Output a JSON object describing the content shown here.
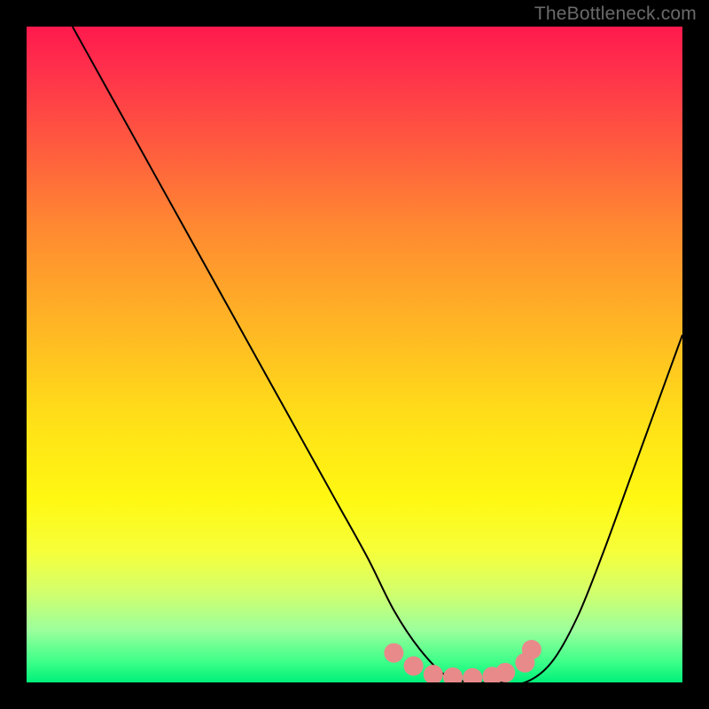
{
  "attribution": "TheBottleneck.com",
  "chart_data": {
    "type": "line",
    "title": "",
    "xlabel": "",
    "ylabel": "",
    "xlim": [
      0,
      100
    ],
    "ylim": [
      0,
      100
    ],
    "series": [
      {
        "name": "bottleneck-curve",
        "x": [
          7,
          12,
          17,
          22,
          27,
          32,
          37,
          42,
          47,
          52,
          56,
          60,
          64,
          68,
          72,
          76,
          80,
          84,
          88,
          92,
          96,
          100
        ],
        "values": [
          100,
          91,
          82,
          73,
          64,
          55,
          46,
          37,
          28,
          19,
          11,
          5,
          1,
          0,
          0,
          0,
          3,
          10,
          20,
          31,
          42,
          53
        ]
      },
      {
        "name": "highlight-dots",
        "x": [
          56,
          59,
          62,
          65,
          68,
          71,
          73,
          76,
          77
        ],
        "values": [
          4.5,
          2.5,
          1.2,
          0.8,
          0.7,
          0.9,
          1.5,
          3,
          5
        ]
      }
    ],
    "colors": {
      "curve": "#000000",
      "highlight": "#e88a8a",
      "gradient_top": "#ff1a4d",
      "gradient_bottom": "#00f07a"
    }
  }
}
